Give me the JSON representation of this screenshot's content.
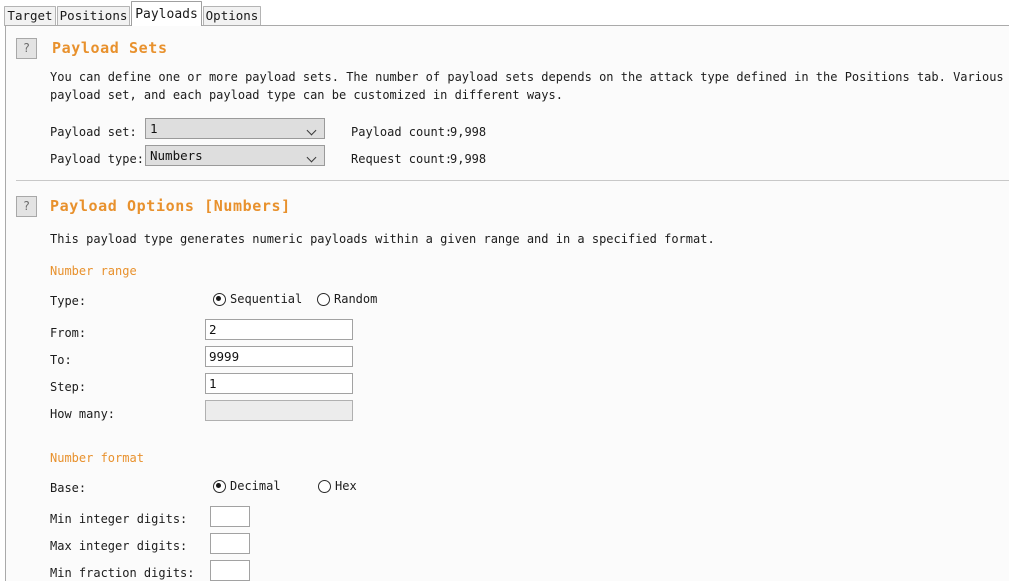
{
  "tabs": [
    {
      "label": "Target",
      "active": false
    },
    {
      "label": "Positions",
      "active": false
    },
    {
      "label": "Payloads",
      "active": true
    },
    {
      "label": "Options",
      "active": false
    }
  ],
  "payload_sets": {
    "help_icon": "?",
    "title": "Payload Sets",
    "description_line1": "You can define one or more payload sets. The number of payload sets depends on the attack type defined in the Positions tab. Various payl",
    "description_line2": "payload set, and each payload type can be customized in different ways.",
    "payload_set_label": "Payload set:",
    "payload_set_value": "1",
    "payload_type_label": "Payload type:",
    "payload_type_value": "Numbers",
    "payload_count_label": "Payload count:",
    "payload_count_value": "9,998",
    "request_count_label": "Request count:",
    "request_count_value": "9,998"
  },
  "payload_options": {
    "help_icon": "?",
    "title": "Payload Options [Numbers]",
    "description": "This payload type generates numeric payloads within a given range and in a specified format.",
    "number_range": {
      "heading": "Number range",
      "type_label": "Type:",
      "type_options": [
        {
          "label": "Sequential",
          "selected": true
        },
        {
          "label": "Random",
          "selected": false
        }
      ],
      "from_label": "From:",
      "from_value": "2",
      "to_label": "To:",
      "to_value": "9999",
      "step_label": "Step:",
      "step_value": "1",
      "how_many_label": "How many:",
      "how_many_value": ""
    },
    "number_format": {
      "heading": "Number format",
      "base_label": "Base:",
      "base_options": [
        {
          "label": "Decimal",
          "selected": true
        },
        {
          "label": "Hex",
          "selected": false
        }
      ],
      "min_integer_digits_label": "Min integer digits:",
      "min_integer_digits_value": "",
      "max_integer_digits_label": "Max integer digits:",
      "max_integer_digits_value": "",
      "min_fraction_digits_label": "Min fraction digits:",
      "min_fraction_digits_value": ""
    }
  },
  "colors": {
    "accent_orange": "#e8912d",
    "panel_bg": "#fbfbfb",
    "tab_inactive_bg": "#f2f2f2",
    "combo_bg": "#dedede",
    "disabled_field_bg": "#ececec"
  }
}
